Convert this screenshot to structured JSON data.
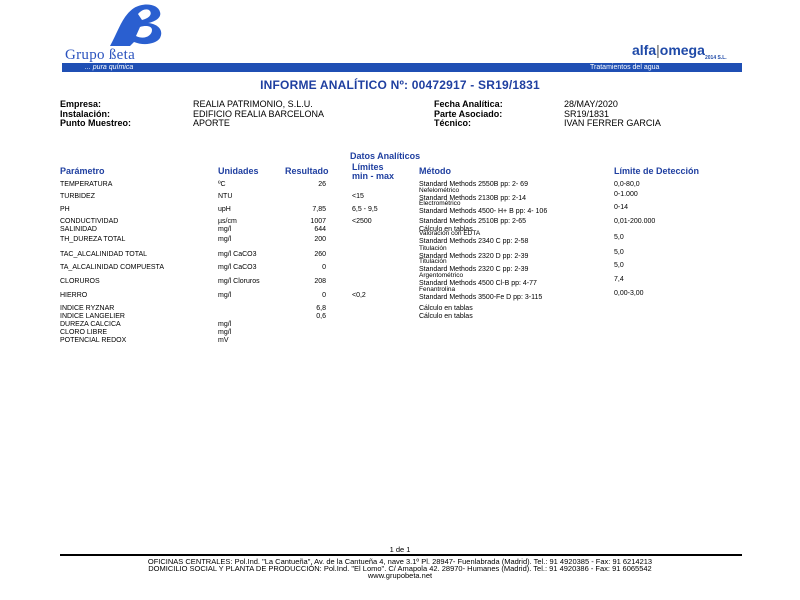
{
  "header": {
    "brand_name": "Grupo ßeta",
    "brand_tagline": "... pura química",
    "partner_name_left": "alfa",
    "partner_name_right": "omega",
    "partner_sub": "2014 S.L.",
    "bar_right_text": "Tratamientos del agua"
  },
  "report_title": "INFORME ANALÍTICO Nº: 00472917 - SR19/1831",
  "info": {
    "empresa_label": "Empresa:",
    "empresa_value": "REALIA PATRIMONIO, S.L.U.",
    "instalacion_label": "Instalación:",
    "instalacion_value": "EDIFICIO REALIA BARCELONA",
    "punto_label": "Punto Muestreo:",
    "punto_value": "APORTE",
    "fecha_label": "Fecha Analítica:",
    "fecha_value": "28/MAY/2020",
    "parte_label": "Parte Asociado:",
    "parte_value": "SR19/1831",
    "tecnico_label": "Técnico:",
    "tecnico_value": "IVAN FERRER GARCIA"
  },
  "section_title": "Datos Analíticos",
  "columns": {
    "parametro": "Parámetro",
    "unidades": "Unidades",
    "resultado": "Resultado",
    "limites_1": "Límites",
    "limites_2": "min - max",
    "metodo": "Método",
    "deteccion": "Límite de Detección"
  },
  "rows": [
    {
      "param": "TEMPERATURA",
      "unit": "ºC",
      "result": "26",
      "limits": "",
      "method1": "Standard Methods 2550B pp: 2- 69",
      "method2": "",
      "det": "0,0-80,0"
    },
    {
      "param": "TURBIDEZ",
      "unit": "NTU",
      "result": "",
      "limits": "<15",
      "method1": "Nefelométrico",
      "method2": "Standard Methods 2130B pp: 2-14",
      "det": "0-1.000"
    },
    {
      "param": "PH",
      "unit": "upH",
      "result": "7,85",
      "limits": "6,5  -  9,5",
      "method1": "Electrométrico",
      "method2": "Standard Methods 4500- H+ B pp: 4- 106",
      "det": "0-14"
    },
    {
      "param": "CONDUCTIVIDAD",
      "unit": "µs/cm",
      "result": "1007",
      "limits": "<2500",
      "method1": "Standard Methods 2510B pp: 2-65",
      "method2": "",
      "det": "0,01-200.000"
    },
    {
      "param": "SALINIDAD",
      "unit": "mg/l",
      "result": "644",
      "limits": "",
      "method1": "Cálculo en tablas",
      "method2": "",
      "det": ""
    },
    {
      "param": "TH_DUREZA TOTAL",
      "unit": "mg/l",
      "result": "200",
      "limits": "",
      "method1": "Valoración con EDTA",
      "method2": "Standard Methods 2340 C pp: 2-58",
      "det": "5,0"
    },
    {
      "param": "TAC_ALCALINIDAD TOTAL",
      "unit": "mg/l CaCO3",
      "result": "260",
      "limits": "",
      "method1": "Titulación",
      "method2": "Standard Methods 2320 D pp: 2-39",
      "det": "5,0"
    },
    {
      "param": "TA_ALCALINIDAD COMPUESTA",
      "unit": "mg/l CaCO3",
      "result": "0",
      "limits": "",
      "method1": "Titulación",
      "method2": "Standard Methods 2320 C pp: 2-39",
      "det": "5,0"
    },
    {
      "param": "CLORUROS",
      "unit": "mg/l Cloruros",
      "result": "208",
      "limits": "",
      "method1": "Argentométrico",
      "method2": "Standard Methods 4500 Cl-B pp: 4-77",
      "det": "7,4"
    },
    {
      "param": "HIERRO",
      "unit": "mg/l",
      "result": "0",
      "limits": "<0,2",
      "method1": "Fenantrolina",
      "method2": "Standard Methods 3500-Fe D pp: 3-115",
      "det": "0,00-3,00"
    },
    {
      "param": "INDICE RYZNAR",
      "unit": "",
      "result": "6,8",
      "limits": "",
      "method1": "Cálculo en tablas",
      "method2": "",
      "det": ""
    },
    {
      "param": "INDICE LANGELIER",
      "unit": "",
      "result": "0,6",
      "limits": "",
      "method1": "Cálculo en tablas",
      "method2": "",
      "det": ""
    },
    {
      "param": "DUREZA CALCICA",
      "unit": "mg/l",
      "result": "",
      "limits": "",
      "method1": "",
      "method2": "",
      "det": ""
    },
    {
      "param": "CLORO LIBRE",
      "unit": "mg/l",
      "result": "",
      "limits": "",
      "method1": "",
      "method2": "",
      "det": ""
    },
    {
      "param": "POTENCIAL REDOX",
      "unit": "mV",
      "result": "",
      "limits": "",
      "method1": "",
      "method2": "",
      "det": ""
    }
  ],
  "footer": {
    "page": "1 de 1",
    "line1": "OFICINAS CENTRALES: Pol.Ind. \"La Cantueña\", Av. de la Cantueña 4, nave 3.1º Pl. 28947- Fuenlabrada (Madrid). Tel.: 91 4920385 - Fax: 91 6214213",
    "line2": "DOMICILIO SOCIAL Y PLANTA DE PRODUCCIÓN: Pol.Ind. \"El Lomo\". C/ Amapola 42. 28970- Humanes (Madrid). Tel.: 91 4920386 - Fax: 91 6065542",
    "line3": "www.grupobeta.net"
  }
}
